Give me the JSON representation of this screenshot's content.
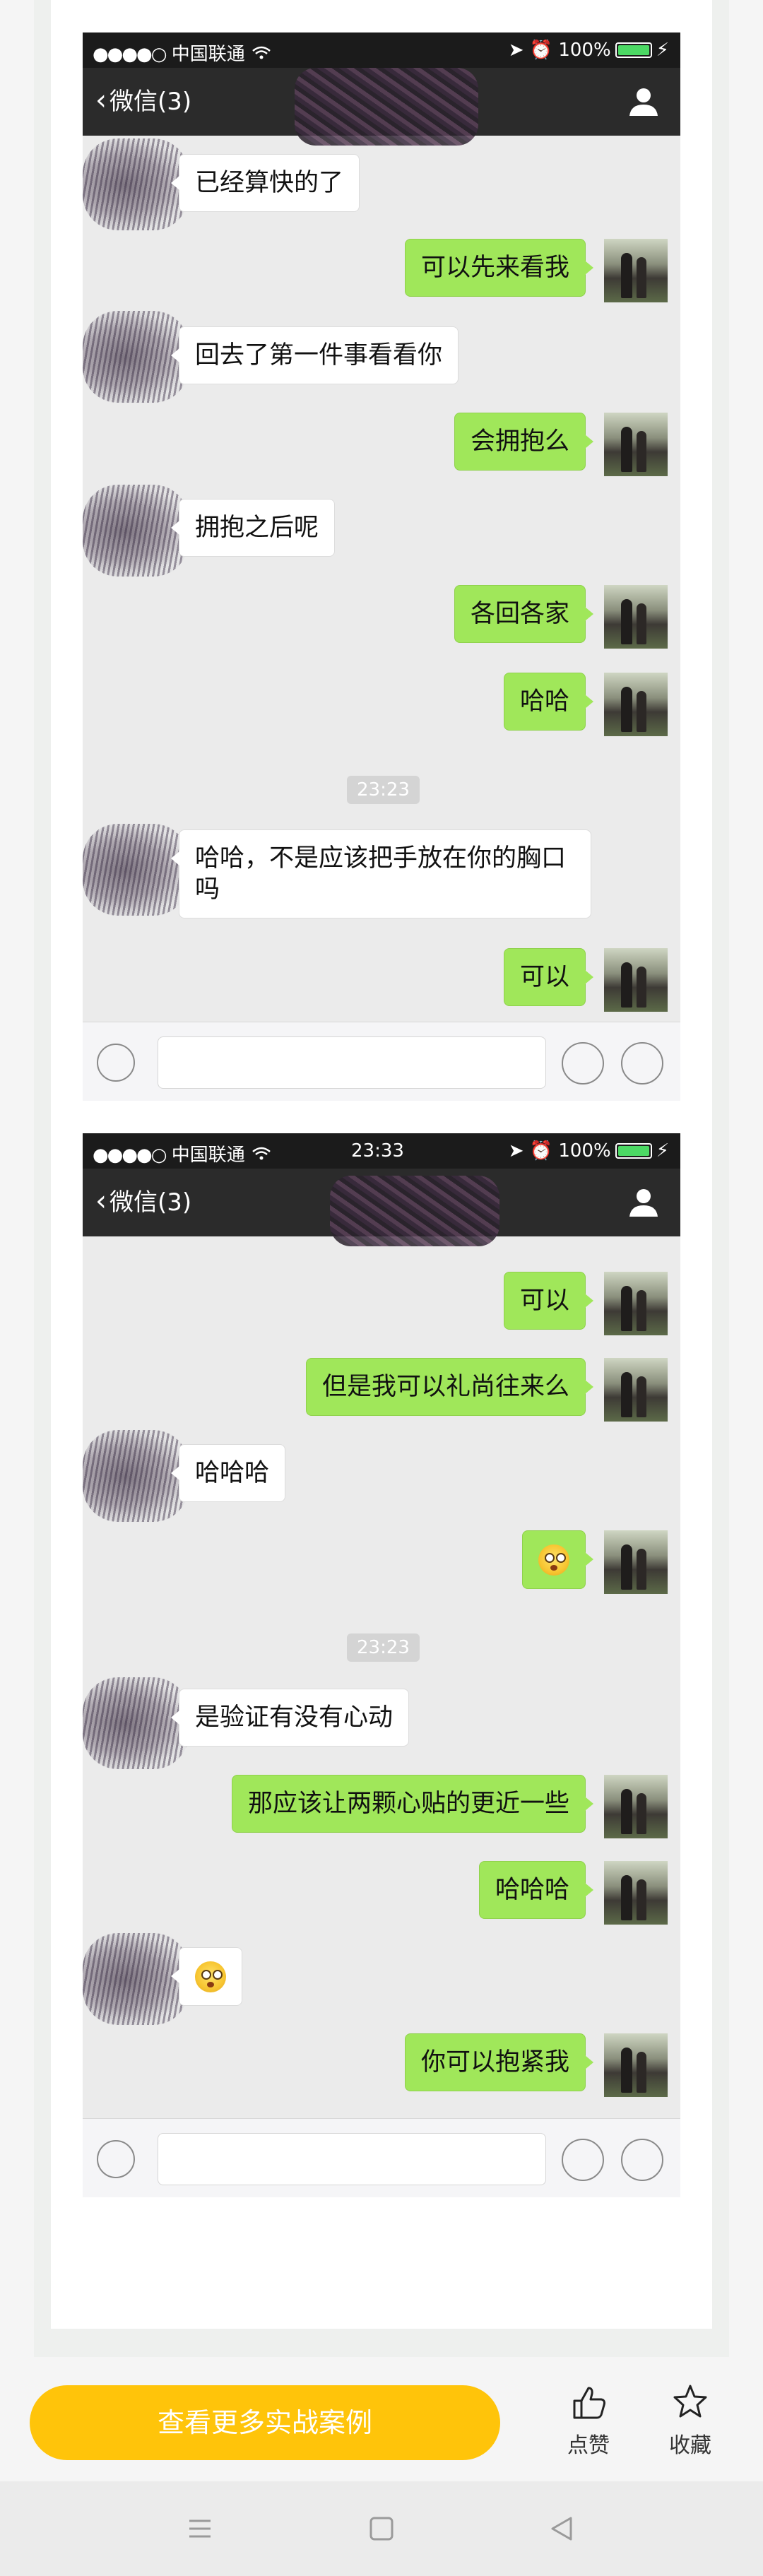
{
  "statusbar": {
    "carrier": "中国联通",
    "time": "23:33",
    "battery": "100%"
  },
  "navbar": {
    "back_label": "微信(3)"
  },
  "screenshot1": {
    "messages": [
      {
        "side": "in",
        "text": "已经算快的了"
      },
      {
        "side": "out",
        "text": "可以先来看我"
      },
      {
        "side": "in",
        "text": "回去了第一件事看看你"
      },
      {
        "side": "out",
        "text": "会拥抱么"
      },
      {
        "side": "in",
        "text": "拥抱之后呢"
      },
      {
        "side": "out",
        "text": "各回各家"
      },
      {
        "side": "out",
        "text": "哈哈"
      },
      {
        "side": "in",
        "text": "哈哈，不是应该把手放在你的胸口吗"
      },
      {
        "side": "out",
        "text": "可以"
      }
    ],
    "timestamp": "23:23"
  },
  "screenshot2": {
    "messages": [
      {
        "side": "out",
        "text": "可以"
      },
      {
        "side": "out",
        "text": "但是我可以礼尚往来么"
      },
      {
        "side": "in",
        "text": "哈哈哈"
      },
      {
        "side": "out",
        "emoji": "flushed-face"
      },
      {
        "side": "in",
        "text": "是验证有没有心动"
      },
      {
        "side": "out",
        "text": "那应该让两颗心贴的更近一些"
      },
      {
        "side": "out",
        "text": "哈哈哈"
      },
      {
        "side": "in",
        "emoji": "flushed-face"
      },
      {
        "side": "out",
        "text": "你可以抱紧我"
      }
    ],
    "timestamp": "23:23"
  },
  "actions": {
    "cta_label": "查看更多实战案例",
    "like_label": "点赞",
    "favorite_label": "收藏"
  },
  "colors": {
    "bubble_out": "#a0e75a",
    "cta": "#ffc40a",
    "nav_dark": "#2b2b2b"
  }
}
